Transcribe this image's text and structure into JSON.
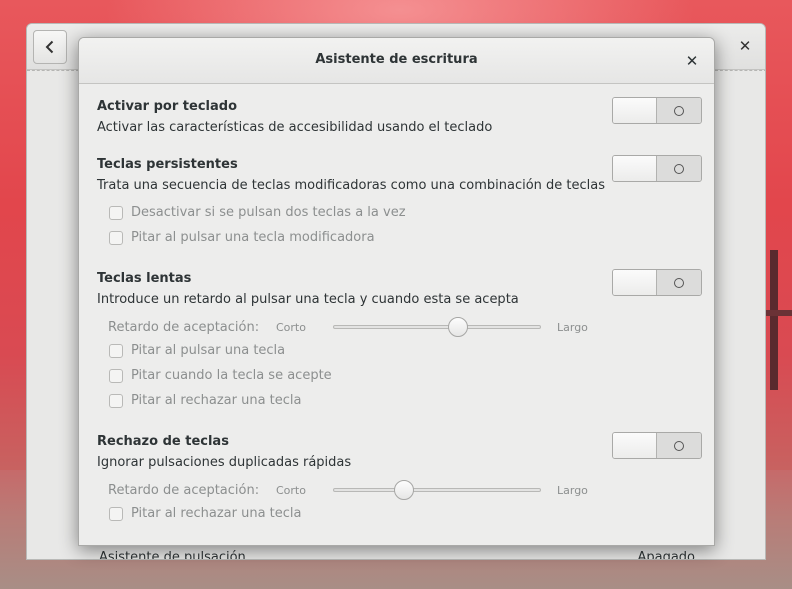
{
  "background_window": {
    "row_label": "Asistente de pulsación",
    "row_value": "Apagado"
  },
  "dialog": {
    "title": "Asistente de escritura",
    "sections": [
      {
        "title": "Activar por teclado",
        "description": "Activar las características de accesibilidad usando el teclado",
        "enabled": false
      },
      {
        "title": "Teclas persistentes",
        "description": "Trata una secuencia de teclas modificadoras como una combinación de teclas",
        "enabled": false,
        "options": [
          "Desactivar si se pulsan dos teclas a la vez",
          "Pitar al pulsar una tecla modificadora"
        ]
      },
      {
        "title": "Teclas lentas",
        "description": "Introduce un retardo al pulsar una tecla y cuando esta se acepta",
        "enabled": false,
        "slider": {
          "label": "Retardo de aceptación:",
          "min_label": "Corto",
          "max_label": "Largo",
          "value": 0.6
        },
        "options": [
          "Pitar al pulsar una tecla",
          "Pitar cuando la tecla se acepte",
          "Pitar al rechazar una tecla"
        ]
      },
      {
        "title": "Rechazo de teclas",
        "description": "Ignorar pulsaciones duplicadas rápidas",
        "enabled": false,
        "slider": {
          "label": "Retardo de aceptación:",
          "min_label": "Corto",
          "max_label": "Largo",
          "value": 0.34
        },
        "options": [
          "Pitar al rechazar una tecla"
        ]
      }
    ]
  },
  "icons": {
    "back": "chevron-left-icon",
    "close": "close-icon",
    "switch_off": "ring-icon"
  }
}
